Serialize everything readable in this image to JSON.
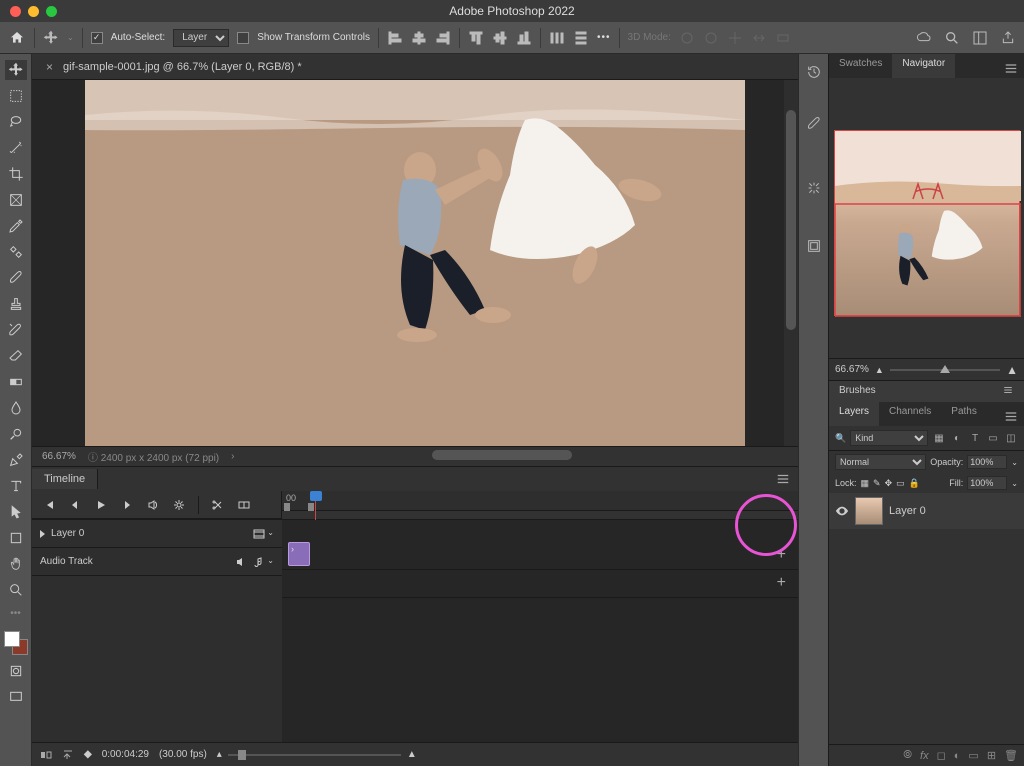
{
  "app": {
    "title": "Adobe Photoshop 2022"
  },
  "options": {
    "auto_select_label": "Auto-Select:",
    "layer_select": "Layer",
    "transform_label": "Show Transform Controls",
    "mode3d_label": "3D Mode:"
  },
  "document": {
    "tab_title": "gif-sample-0001.jpg @ 66.7% (Layer 0, RGB/8) *",
    "zoom": "66.67%",
    "dims": "2400 px x 2400 px (72 ppi)"
  },
  "timeline": {
    "panel_title": "Timeline",
    "track_layer": "Layer 0",
    "track_audio": "Audio Track",
    "ruler_tick": "00",
    "timecode": "0:00:04:29",
    "fps": "(30.00 fps)"
  },
  "rightpanels": {
    "swatches_tab": "Swatches",
    "navigator_tab": "Navigator",
    "nav_zoom": "66.67%",
    "brushes_tab": "Brushes",
    "layers_tab": "Layers",
    "channels_tab": "Channels",
    "paths_tab": "Paths"
  },
  "layers": {
    "kind_filter": "Kind",
    "blend_mode": "Normal",
    "opacity_label": "Opacity:",
    "opacity_value": "100%",
    "lock_label": "Lock:",
    "fill_label": "Fill:",
    "fill_value": "100%",
    "layer0_name": "Layer 0"
  },
  "footer_icons": {
    "link": "⦾",
    "fx": "fx",
    "mask": "◻",
    "adj": "◐",
    "group": "▭",
    "new": "⊞",
    "trash": "🗑"
  }
}
